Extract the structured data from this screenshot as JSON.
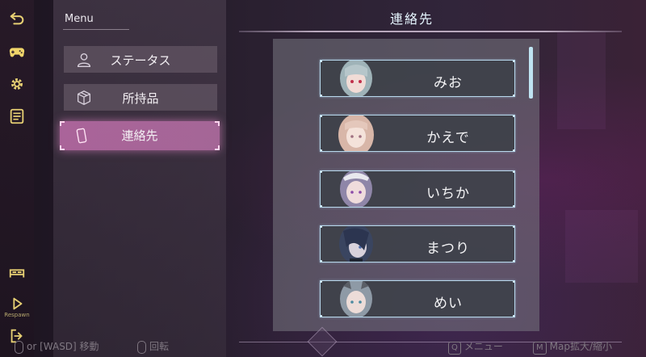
{
  "menu": {
    "title": "Menu",
    "items": [
      {
        "label": "ステータス",
        "icon": "person-icon"
      },
      {
        "label": "所持品",
        "icon": "box-icon"
      },
      {
        "label": "連絡先",
        "icon": "phone-icon",
        "active": true
      }
    ]
  },
  "rail": {
    "icons": [
      "back-arrow-icon",
      "gamepad-icon",
      "gear-icon",
      "document-icon",
      "double-bed-icon",
      "respawn-icon",
      "exit-icon"
    ],
    "respawn_label": "Respawn"
  },
  "contacts": {
    "title": "連絡先",
    "items": [
      {
        "name": "みお",
        "hair": "#9fb3b8"
      },
      {
        "name": "かえで",
        "hair": "#d8b6a8"
      },
      {
        "name": "いちか",
        "hair": "#8f86a8"
      },
      {
        "name": "まつり",
        "hair": "#3a4560"
      },
      {
        "name": "めい",
        "hair": "#8e9aa6"
      }
    ]
  },
  "hints": {
    "move": "or [WASD] 移動",
    "rotate": "回転",
    "menu_key": "Q",
    "menu": "メニュー",
    "map_key": "M",
    "map": "Map拡大/縮小"
  },
  "colors": {
    "accent": "#c86ea8",
    "frame": "#b8d8ec",
    "rail_icon": "#e6cf73"
  }
}
